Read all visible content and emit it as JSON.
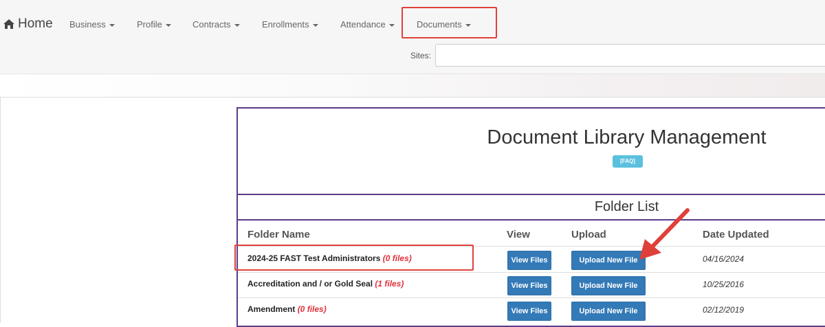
{
  "nav": {
    "home": "Home",
    "items": [
      "Business",
      "Profile",
      "Contracts",
      "Enrollments",
      "Attendance",
      "Documents"
    ]
  },
  "sites": {
    "label": "Sites:",
    "value": ""
  },
  "panel": {
    "title": "Document Library Management",
    "faq": "[FAQ]",
    "folder_list_title": "Folder List",
    "columns": [
      "Folder Name",
      "View",
      "Upload",
      "Date Updated"
    ]
  },
  "rows": [
    {
      "name": "2024-25 FAST Test Administrators",
      "count": "(0 files)",
      "view": "View Files",
      "upload": "Upload New File",
      "date": "04/16/2024"
    },
    {
      "name": "Accreditation and / or Gold Seal",
      "count": "(1 files)",
      "view": "View Files",
      "upload": "Upload New File",
      "date": "10/25/2016"
    },
    {
      "name": "Amendment",
      "count": "(0 files)",
      "view": "View Files",
      "upload": "Upload New File",
      "date": "02/12/2019"
    }
  ],
  "colors": {
    "highlight": "#e0403a",
    "panel_border": "#5b3a8a",
    "button": "#337ab7",
    "faq": "#5bc0de",
    "file_count": "#e0303a"
  },
  "icons": {
    "home": "home-icon",
    "caret": "caret-down-icon",
    "annotation": "arrow-annotation"
  }
}
